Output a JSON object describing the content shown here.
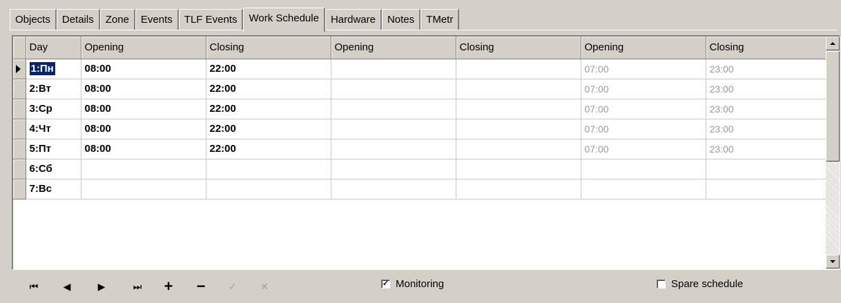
{
  "tabs": [
    "Objects",
    "Details",
    "Zone",
    "Events",
    "TLF Events",
    "Work Schedule",
    "Hardware",
    "Notes",
    "TMetr"
  ],
  "active_tab": "Work Schedule",
  "grid": {
    "columns": [
      "Day",
      "Opening",
      "Closing",
      "Opening",
      "Closing",
      "Opening",
      "Closing"
    ],
    "rows": [
      [
        "1:Пн",
        "08:00",
        "22:00",
        "",
        "",
        "07:00",
        "23:00"
      ],
      [
        "2:Вт",
        "08:00",
        "22:00",
        "",
        "",
        "07:00",
        "23:00"
      ],
      [
        "3:Ср",
        "08:00",
        "22:00",
        "",
        "",
        "07:00",
        "23:00"
      ],
      [
        "4:Чт",
        "08:00",
        "22:00",
        "",
        "",
        "07:00",
        "23:00"
      ],
      [
        "5:Пт",
        "08:00",
        "22:00",
        "",
        "",
        "07:00",
        "23:00"
      ],
      [
        "6:Сб",
        "",
        "",
        "",
        "",
        "",
        ""
      ],
      [
        "7:Вс",
        "",
        "",
        "",
        "",
        "",
        ""
      ]
    ],
    "selected_row": 0
  },
  "navigator": {
    "first": "⏮",
    "prior": "◀",
    "next": "▶",
    "last": "⏭",
    "insert": "+",
    "delete": "−",
    "post": "✓",
    "cancel": "✕"
  },
  "checkboxes": {
    "monitoring": {
      "label": "Monitoring",
      "checked": true,
      "mark": "✓"
    },
    "spare_schedule": {
      "label": "Spare schedule",
      "checked": false,
      "mark": ""
    }
  }
}
